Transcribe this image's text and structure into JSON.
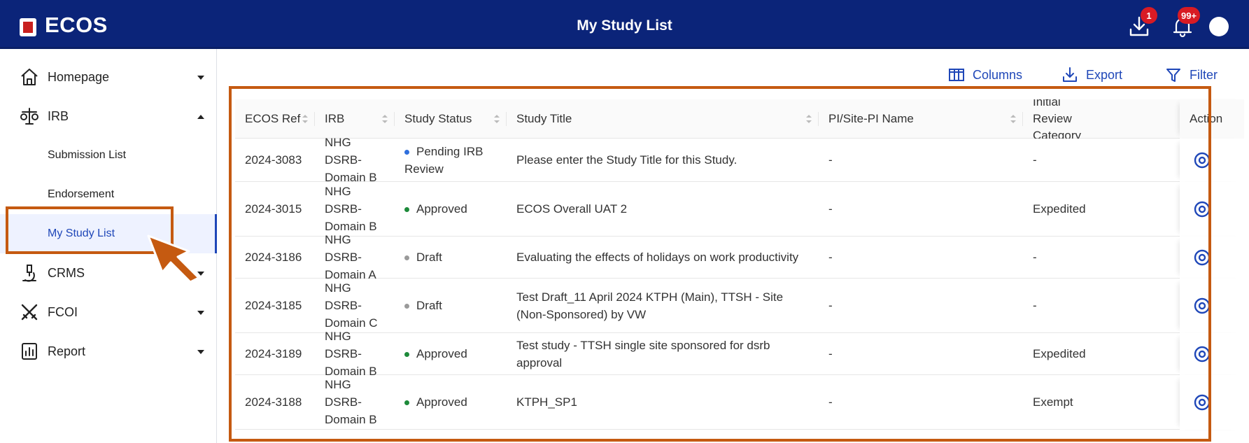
{
  "app": {
    "logo_text": "ECOS",
    "title": "My Study List"
  },
  "header": {
    "download_badge": "1",
    "bell_badge": "99+"
  },
  "sidebar": {
    "items": [
      {
        "label": "Homepage",
        "icon": "home-icon"
      },
      {
        "label": "IRB",
        "icon": "scales-icon"
      },
      {
        "label": "CRMS",
        "icon": "microscope-icon"
      },
      {
        "label": "FCOI",
        "icon": "crossed-swords-icon"
      },
      {
        "label": "Report",
        "icon": "report-icon"
      }
    ],
    "sub_items": [
      {
        "label": "Submission List"
      },
      {
        "label": "Endorsement"
      },
      {
        "label": "My Study List"
      }
    ]
  },
  "toolbar": {
    "columns_label": "Columns",
    "export_label": "Export",
    "filter_label": "Filter"
  },
  "table": {
    "headers": [
      "ECOS Ref",
      "IRB",
      "Study Status",
      "Study Title",
      "PI/Site-PI Name",
      "Initial Review Category",
      "Action"
    ],
    "rows": [
      {
        "ref": "2024-3083",
        "irb": "NHG DSRB-Domain B",
        "status": "Pending IRB Review",
        "status_color": "#2f6fdd",
        "title": "Please enter the Study Title for this Study.",
        "pi": "-",
        "category": "-"
      },
      {
        "ref": "2024-3015",
        "irb": "NHG DSRB-Domain B",
        "status": "Approved",
        "status_color": "#1d8a3a",
        "title": "ECOS Overall UAT 2",
        "pi": "-",
        "category": "Expedited"
      },
      {
        "ref": "2024-3186",
        "irb": "NHG DSRB-Domain A",
        "status": "Draft",
        "status_color": "#9a9a9a",
        "title": "Evaluating the effects of holidays on work productivity",
        "pi": "-",
        "category": "-"
      },
      {
        "ref": "2024-3185",
        "irb": "NHG DSRB-Domain C",
        "status": "Draft",
        "status_color": "#9a9a9a",
        "title": "Test Draft_11 April 2024 KTPH (Main), TTSH - Site (Non-Sponsored) by VW",
        "pi": "-",
        "category": "-"
      },
      {
        "ref": "2024-3189",
        "irb": "NHG DSRB-Domain B",
        "status": "Approved",
        "status_color": "#1d8a3a",
        "title": "Test study - TTSH single site sponsored for dsrb approval",
        "pi": "-",
        "category": "Expedited"
      },
      {
        "ref": "2024-3188",
        "irb": "NHG DSRB-Domain B",
        "status": "Approved",
        "status_color": "#1d8a3a",
        "title": "KTPH_SP1",
        "pi": "-",
        "category": "Exempt"
      }
    ]
  },
  "colors": {
    "header_bg": "#0b2479",
    "accent": "#1f47b8",
    "annotation": "#c55a11"
  }
}
